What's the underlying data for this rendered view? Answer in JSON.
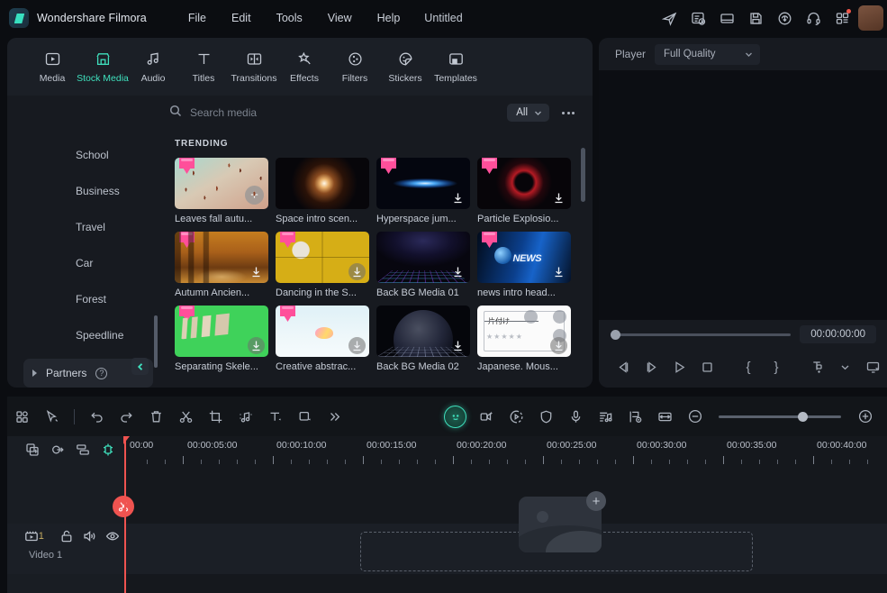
{
  "titlebar": {
    "brand": "Wondershare Filmora",
    "document_title": "Untitled",
    "menus": [
      "File",
      "Edit",
      "Tools",
      "View",
      "Help"
    ],
    "right_icons": [
      "share-icon",
      "task-list-icon",
      "layout-icon",
      "save-icon",
      "cloud-upload-icon",
      "headset-icon",
      "dashboard-grid-icon"
    ]
  },
  "tabs": [
    {
      "label": "Media",
      "icon": "media-icon",
      "active": false
    },
    {
      "label": "Stock Media",
      "icon": "store-icon",
      "active": true
    },
    {
      "label": "Audio",
      "icon": "audio-note-icon",
      "active": false
    },
    {
      "label": "Titles",
      "icon": "text-t-icon",
      "active": false
    },
    {
      "label": "Transitions",
      "icon": "transitions-icon",
      "active": false
    },
    {
      "label": "Effects",
      "icon": "effects-wand-icon",
      "active": false
    },
    {
      "label": "Filters",
      "icon": "filters-circle-icon",
      "active": false
    },
    {
      "label": "Stickers",
      "icon": "sticker-face-icon",
      "active": false
    },
    {
      "label": "Templates",
      "icon": "templates-icon",
      "active": false
    }
  ],
  "search": {
    "placeholder": "Search media",
    "value": "",
    "filter_label": "All",
    "more_label": "more-options"
  },
  "sidebar": {
    "items": [
      "School",
      "Business",
      "Travel",
      "Car",
      "Forest",
      "Speedline"
    ],
    "partners": {
      "label": "Partners",
      "help": "?"
    }
  },
  "media": {
    "section_title": "TRENDING",
    "cards": [
      {
        "name": "Leaves fall autu...",
        "art": "t-leaves",
        "premium": true,
        "action": "add"
      },
      {
        "name": "Space intro scen...",
        "art": "t-space",
        "premium": true,
        "action": "download"
      },
      {
        "name": "Hyperspace jum...",
        "art": "t-hyper",
        "premium": true,
        "action": "download"
      },
      {
        "name": "Particle Explosio...",
        "art": "t-particle",
        "premium": true,
        "action": "download"
      },
      {
        "name": "Autumn Ancien...",
        "art": "t-autumn",
        "premium": true,
        "action": "download"
      },
      {
        "name": "Dancing in the S...",
        "art": "t-dancing",
        "premium": true,
        "action": "download-filled"
      },
      {
        "name": "Back BG Media 01",
        "art": "t-backbg1",
        "premium": false,
        "action": "download"
      },
      {
        "name": "news intro head...",
        "art": "t-news",
        "premium": true,
        "action": "download"
      },
      {
        "name": "Separating Skele...",
        "art": "t-skeleton",
        "premium": true,
        "action": "download-filled"
      },
      {
        "name": "Creative abstrac...",
        "art": "t-creative",
        "premium": true,
        "action": "download-filled"
      },
      {
        "name": "Back BG Media 02",
        "art": "t-backbg2",
        "premium": false,
        "action": "download"
      },
      {
        "name": "Japanese. Mous...",
        "art": "t-japanese",
        "premium": false,
        "action": "download-filled"
      }
    ]
  },
  "player": {
    "label": "Player",
    "quality": "Full Quality",
    "timecode": "00:00:00:00",
    "controls": [
      "prev-frame-icon",
      "next-frame-icon",
      "play-icon",
      "stop-icon",
      "mark-in-icon",
      "mark-out-icon",
      "snapshot-icon",
      "chevron-down-icon",
      "display-icon"
    ]
  },
  "timeline_toolbar": {
    "left_icons": [
      "apps-grid-icon",
      "select-tool-icon",
      "undo-icon",
      "redo-icon",
      "delete-icon",
      "split-icon",
      "crop-icon",
      "audio-detach-icon",
      "text-tool-icon",
      "shape-tool-icon",
      "more-chevrons-icon"
    ],
    "right_icons": [
      "ai-smart-icon",
      "ai-video-icon",
      "record-icon",
      "shield-icon",
      "microphone-icon",
      "audio-mixer-icon",
      "marker-icon",
      "fit-timeline-icon",
      "zoom-out-icon",
      "zoom-in-icon"
    ],
    "zoom_position": "65"
  },
  "timeline": {
    "track_header_icons": [
      "add-track-icon",
      "link-clip-icon",
      "track-manager-icon",
      "snap-magnet-icon"
    ],
    "track": {
      "name": "Video 1",
      "count": "1",
      "row_icons": [
        "film-icon",
        "lock-icon",
        "mute-icon",
        "eye-icon"
      ]
    },
    "ruler_labels": [
      "00:00",
      "00:00:05:00",
      "00:00:10:00",
      "00:00:15:00",
      "00:00:20:00",
      "00:00:25:00",
      "00:00:30:00",
      "00:00:35:00",
      "00:00:40:00"
    ],
    "dropzone_hint": "drop-media-here",
    "playhead_position": "00:00"
  },
  "colors": {
    "accent": "#3fe0bd",
    "playhead": "#ef5350",
    "premium_badge": "#ff4f9a",
    "panel_bg": "#171a20",
    "app_bg": "#0b0d11"
  }
}
